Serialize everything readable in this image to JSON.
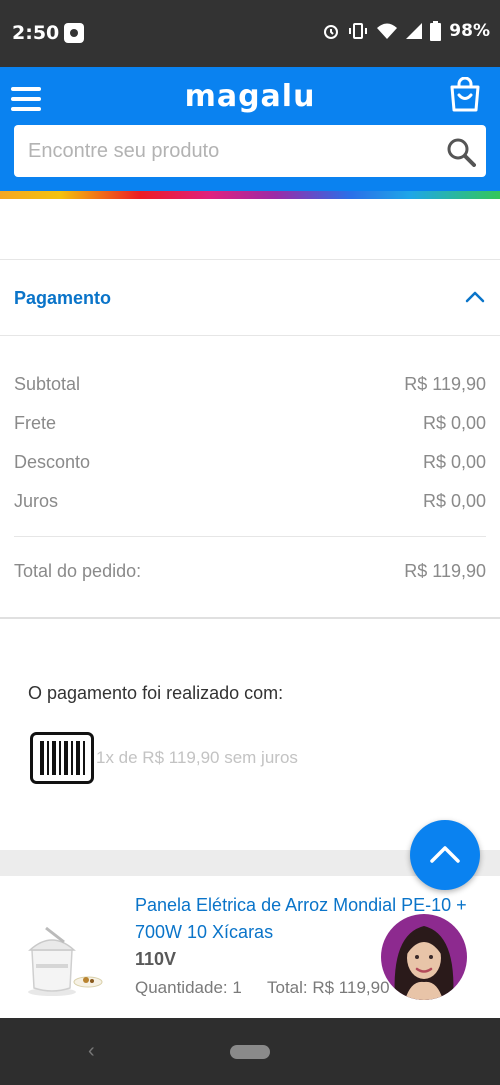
{
  "status_bar": {
    "time": "2:50",
    "battery": "98%",
    "icons": [
      "camera-icon",
      "alarm-icon",
      "vibrate-icon",
      "wifi-icon",
      "signal-icon",
      "battery-icon"
    ]
  },
  "header": {
    "logo": "magalu",
    "search_placeholder": "Encontre seu produto",
    "colors": {
      "brand": "#0a82f0",
      "link": "#0a74c9"
    }
  },
  "payment": {
    "title": "Pagamento",
    "rows": [
      {
        "label": "Subtotal",
        "value": "R$ 119,90"
      },
      {
        "label": "Frete",
        "value": "R$ 0,00"
      },
      {
        "label": "Desconto",
        "value": "R$ 0,00"
      },
      {
        "label": "Juros",
        "value": "R$ 0,00"
      }
    ],
    "total_label": "Total do pedido:",
    "total_value": "R$ 119,90",
    "paid_with_label": "O pagamento foi realizado com:",
    "installments": "1x de R$ 119,90 sem juros"
  },
  "product": {
    "name": "Panela Elétrica de Arroz Mondial PE-10 + 700W 10 Xícaras",
    "variant": "110V",
    "quantity": "Quantidade: 1",
    "total": "Total: R$ 119,90"
  }
}
